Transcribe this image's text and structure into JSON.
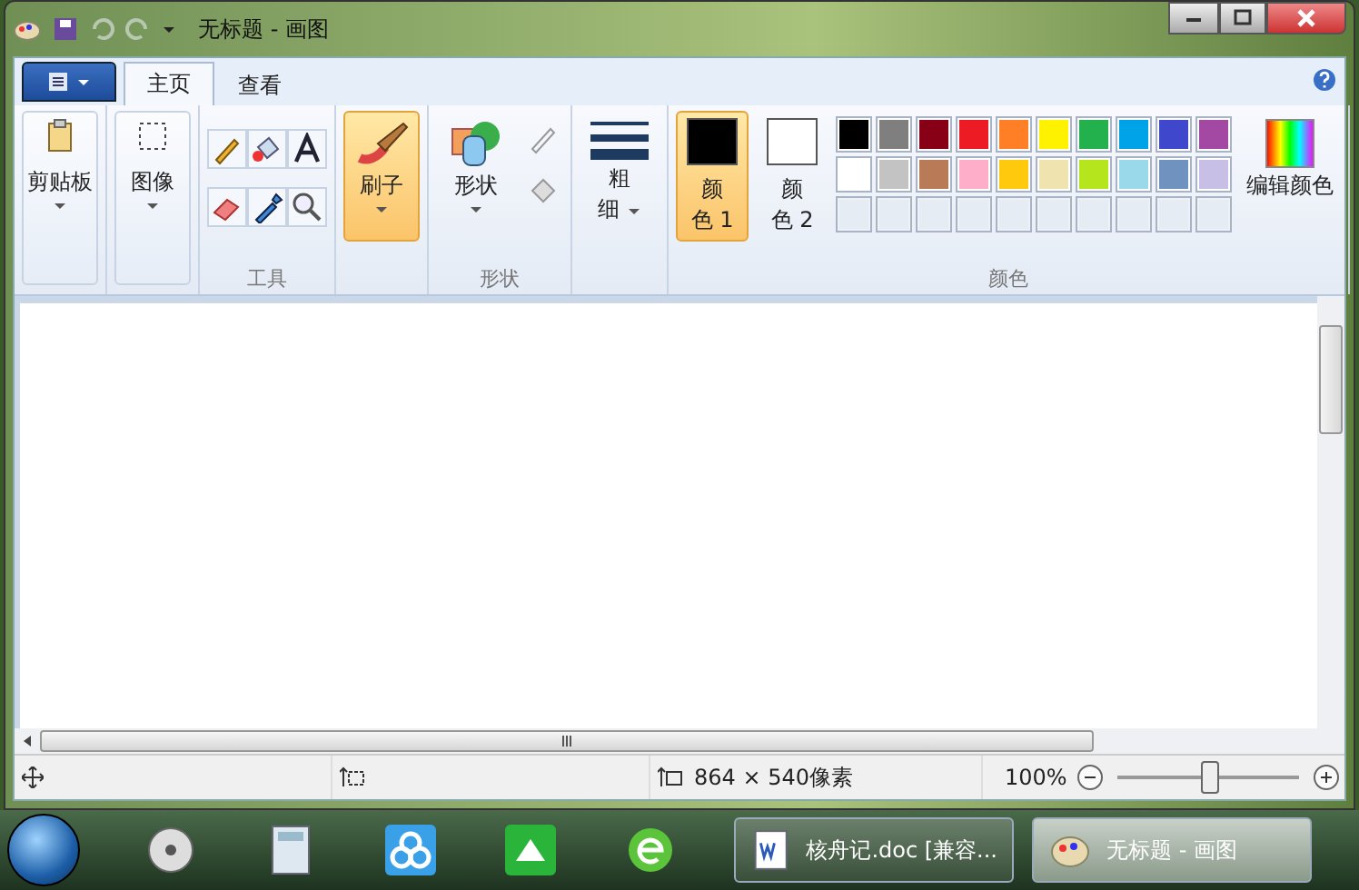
{
  "window": {
    "title": "无标题 - 画图"
  },
  "ribbon": {
    "tabs": [
      {
        "label": "主页",
        "selected": true
      },
      {
        "label": "查看",
        "selected": false
      }
    ],
    "groups": [
      {
        "kind": "paste",
        "label": "剪贴板"
      },
      {
        "kind": "image",
        "label": "图像"
      },
      {
        "kind": "tools",
        "label": "工具"
      },
      {
        "kind": "brush",
        "label": "刷子",
        "selected": true
      },
      {
        "kind": "shapes",
        "label": "形状",
        "title": "形状"
      },
      {
        "kind": "size",
        "label": "粗",
        "label2": "细"
      },
      {
        "kind": "colors",
        "title": "颜色",
        "color1": {
          "label": "颜",
          "label2": "色 1",
          "selected": true,
          "color": "#000000"
        },
        "color2": {
          "label": "颜",
          "label2": "色 2",
          "selected": false,
          "color": "#ffffff"
        },
        "edit": "编辑颜色",
        "palette": [
          {
            "kind": "swatch",
            "color": "#000000"
          },
          {
            "kind": "swatch",
            "color": "#7f7f7f"
          },
          {
            "kind": "swatch",
            "color": "#880015"
          },
          {
            "kind": "swatch",
            "color": "#ed1c24"
          },
          {
            "kind": "swatch",
            "color": "#ff7f27"
          },
          {
            "kind": "swatch",
            "color": "#fff200"
          },
          {
            "kind": "swatch",
            "color": "#22b14c"
          },
          {
            "kind": "swatch",
            "color": "#00a2e8"
          },
          {
            "kind": "swatch",
            "color": "#3f48cc"
          },
          {
            "kind": "swatch",
            "color": "#a349a4"
          },
          {
            "kind": "swatch",
            "color": "#ffffff"
          },
          {
            "kind": "swatch",
            "color": "#c3c3c3"
          },
          {
            "kind": "swatch",
            "color": "#b97a57"
          },
          {
            "kind": "swatch",
            "color": "#ffaec9"
          },
          {
            "kind": "swatch",
            "color": "#ffc90e"
          },
          {
            "kind": "swatch",
            "color": "#efe4b0"
          },
          {
            "kind": "swatch",
            "color": "#b5e61d"
          },
          {
            "kind": "swatch",
            "color": "#99d9ea"
          },
          {
            "kind": "swatch",
            "color": "#7092be"
          },
          {
            "kind": "swatch",
            "color": "#c8bfe7"
          },
          {
            "kind": "empty"
          },
          {
            "kind": "empty"
          },
          {
            "kind": "empty"
          },
          {
            "kind": "empty"
          },
          {
            "kind": "empty"
          },
          {
            "kind": "empty"
          },
          {
            "kind": "empty"
          },
          {
            "kind": "empty"
          },
          {
            "kind": "empty"
          },
          {
            "kind": "empty"
          }
        ]
      }
    ]
  },
  "status_bar": {
    "image_size": "864 × 540像素",
    "zoom": "100%",
    "zoom_level": {
      "level": 0.5
    }
  },
  "taskbar": {
    "windows": [
      {
        "label": "核舟记.doc [兼容...",
        "selected": false
      },
      {
        "label": "无标题 - 画图",
        "selected": true
      }
    ]
  }
}
